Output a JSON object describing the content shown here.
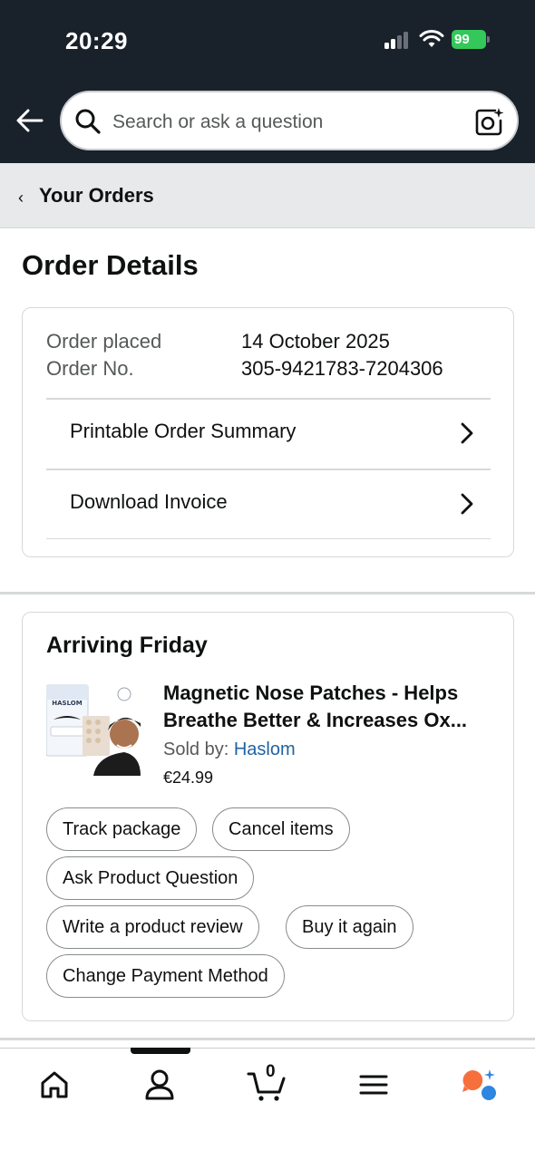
{
  "status_bar": {
    "time": "20:29",
    "battery": "99"
  },
  "header": {
    "search_placeholder": "Search or ask a question"
  },
  "breadcrumb": {
    "label": "Your Orders"
  },
  "page": {
    "title": "Order Details"
  },
  "order_info": {
    "placed_label": "Order placed",
    "placed_value": "14 October 2025",
    "number_label": "Order No.",
    "number_value": "305-9421783-7204306",
    "links": [
      "Printable Order Summary",
      "Download Invoice"
    ]
  },
  "shipment": {
    "status": "Arriving Friday",
    "product": {
      "title_line1": "Magnetic Nose Patches - Helps",
      "title_line2": "Breathe Better & Increases Ox...",
      "sold_by_label": "Sold by:",
      "seller": "Haslom",
      "price": "€24.99",
      "image_brand": "HASLOM"
    },
    "actions": [
      "Track package",
      "Cancel items",
      "Ask Product Question",
      "Write a product review",
      "Buy it again",
      "Change Payment Method"
    ]
  },
  "tabbar": {
    "cart_count": "0",
    "items": [
      "home-icon",
      "account-icon",
      "cart-icon",
      "menu-icon",
      "rufus-icon"
    ],
    "active": "account-icon"
  },
  "colors": {
    "header_bg": "#19212b",
    "link": "#2162a1",
    "battery": "#34c759",
    "rufus_orange": "#f76f3d",
    "rufus_blue": "#2f86e0"
  }
}
